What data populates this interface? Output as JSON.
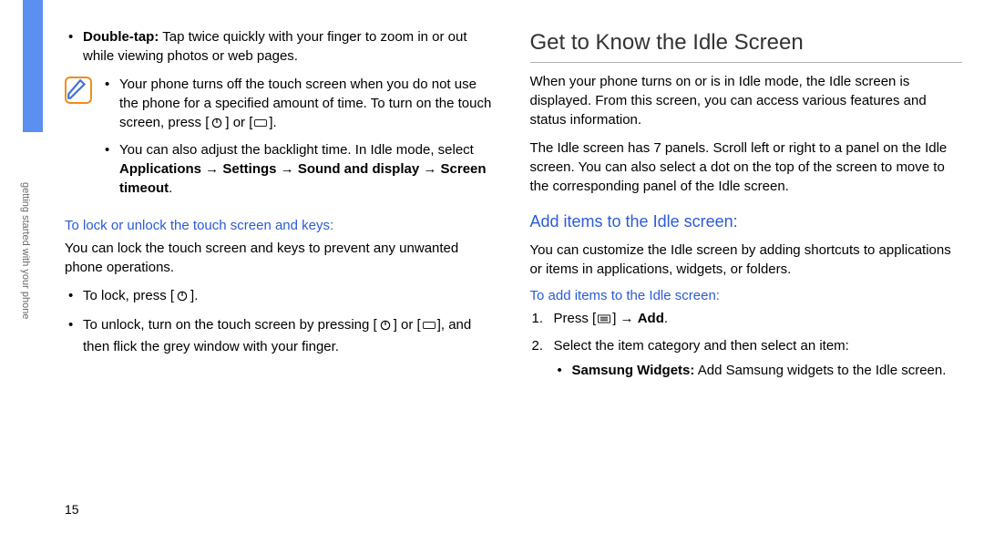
{
  "side_label": "getting started with your phone",
  "page_number": "15",
  "left": {
    "bullet1": {
      "label": "Double-tap:",
      "text": " Tap twice quickly with your finger to zoom in or out while viewing photos or web pages."
    },
    "note": {
      "item1a": "Your phone turns off the touch screen when you do not use the phone for a specified amount of time. To turn on the touch screen, press [",
      "item1b": "] or [",
      "item1c": "].",
      "item2a": "You can also adjust the backlight time. In Idle mode, select ",
      "item2bold": "Applications → Settings → Sound and display → Screen timeout",
      "item2end": "."
    },
    "lock_heading": "To lock or unlock the touch screen and keys:",
    "lock_para": "You can lock the touch screen and keys to prevent any unwanted phone operations.",
    "lock_item1a": "To lock, press [",
    "lock_item1b": "].",
    "lock_item2a": "To unlock, turn on the touch screen by pressing [",
    "lock_item2b": "] or [",
    "lock_item2c": "], and then flick the grey window with your finger."
  },
  "right": {
    "title": "Get to Know the Idle Screen",
    "para1": "When your phone turns on or is in Idle mode, the Idle screen is displayed. From this screen, you can access various features and status information.",
    "para2": "The Idle screen has 7 panels. Scroll left or right to a panel on the Idle screen. You can also select a dot on the top of the screen to move to the corresponding panel of the Idle screen.",
    "sub1": "Add items to the Idle screen:",
    "sub1_para": "You can customize the Idle screen by adding shortcuts to applications or items in applications, widgets, or folders.",
    "sub1_heading": "To add items to the Idle screen:",
    "step1a": "Press [",
    "step1b": "] → ",
    "step1bold": "Add",
    "step1end": ".",
    "step2": "Select the item category and then select an item:",
    "step2_sub_bold": "Samsung Widgets:",
    "step2_sub_text": " Add Samsung widgets to the Idle screen."
  }
}
